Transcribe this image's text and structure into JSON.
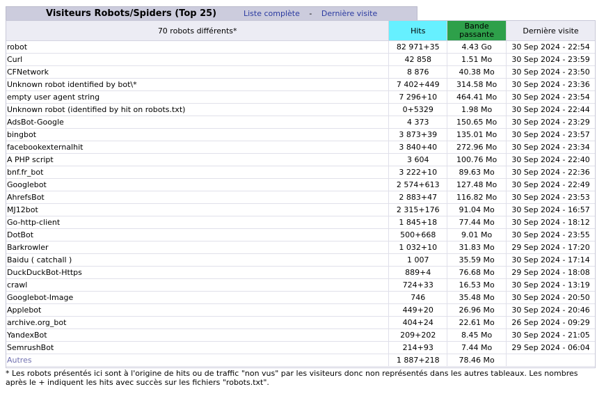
{
  "header": {
    "title": "Visiteurs Robots/Spiders (Top 25)",
    "link_full": "Liste complète",
    "separator": "-",
    "link_last": "Dernière visite"
  },
  "table": {
    "col_name": "70 robots différents*",
    "col_hits": "Hits",
    "col_bandwidth_line1": "Bande",
    "col_bandwidth_line2": "passante",
    "col_last": "Dernière visite",
    "colors": {
      "hits_header": "#66f0ff",
      "bandwidth_header": "#2ea04a"
    },
    "rows": [
      {
        "name": "robot",
        "hits": "82 971+35",
        "bandwidth": "4.43 Go",
        "last": "30 Sep 2024 - 22:54"
      },
      {
        "name": "Curl",
        "hits": "42 858",
        "bandwidth": "1.51 Mo",
        "last": "30 Sep 2024 - 23:59"
      },
      {
        "name": "CFNetwork",
        "hits": "8 876",
        "bandwidth": "40.38 Mo",
        "last": "30 Sep 2024 - 23:50"
      },
      {
        "name": "Unknown robot identified by bot\\*",
        "hits": "7 402+449",
        "bandwidth": "314.58 Mo",
        "last": "30 Sep 2024 - 23:36"
      },
      {
        "name": "empty user agent string",
        "hits": "7 296+10",
        "bandwidth": "464.41 Mo",
        "last": "30 Sep 2024 - 23:54"
      },
      {
        "name": "Unknown robot (identified by hit on robots.txt)",
        "hits": "0+5329",
        "bandwidth": "1.98 Mo",
        "last": "30 Sep 2024 - 22:44"
      },
      {
        "name": "AdsBot-Google",
        "hits": "4 373",
        "bandwidth": "150.65 Mo",
        "last": "30 Sep 2024 - 23:29"
      },
      {
        "name": "bingbot",
        "hits": "3 873+39",
        "bandwidth": "135.01 Mo",
        "last": "30 Sep 2024 - 23:57"
      },
      {
        "name": "facebookexternalhit",
        "hits": "3 840+40",
        "bandwidth": "272.96 Mo",
        "last": "30 Sep 2024 - 23:34"
      },
      {
        "name": "A PHP script",
        "hits": "3 604",
        "bandwidth": "100.76 Mo",
        "last": "30 Sep 2024 - 22:40"
      },
      {
        "name": "bnf.fr_bot",
        "hits": "3 222+10",
        "bandwidth": "89.63 Mo",
        "last": "30 Sep 2024 - 22:36"
      },
      {
        "name": "Googlebot",
        "hits": "2 574+613",
        "bandwidth": "127.48 Mo",
        "last": "30 Sep 2024 - 22:49"
      },
      {
        "name": "AhrefsBot",
        "hits": "2 883+47",
        "bandwidth": "116.82 Mo",
        "last": "30 Sep 2024 - 23:53"
      },
      {
        "name": "MJ12bot",
        "hits": "2 315+176",
        "bandwidth": "91.04 Mo",
        "last": "30 Sep 2024 - 16:57"
      },
      {
        "name": "Go-http-client",
        "hits": "1 845+18",
        "bandwidth": "77.44 Mo",
        "last": "30 Sep 2024 - 18:12"
      },
      {
        "name": "DotBot",
        "hits": "500+668",
        "bandwidth": "9.01 Mo",
        "last": "30 Sep 2024 - 23:55"
      },
      {
        "name": "Barkrowler",
        "hits": "1 032+10",
        "bandwidth": "31.83 Mo",
        "last": "29 Sep 2024 - 17:20"
      },
      {
        "name": "Baidu ( catchall )",
        "hits": "1 007",
        "bandwidth": "35.59 Mo",
        "last": "30 Sep 2024 - 17:14"
      },
      {
        "name": "DuckDuckBot-Https",
        "hits": "889+4",
        "bandwidth": "76.68 Mo",
        "last": "29 Sep 2024 - 18:08"
      },
      {
        "name": "crawl",
        "hits": "724+33",
        "bandwidth": "16.53 Mo",
        "last": "30 Sep 2024 - 13:19"
      },
      {
        "name": "Googlebot-Image",
        "hits": "746",
        "bandwidth": "35.48 Mo",
        "last": "30 Sep 2024 - 20:50"
      },
      {
        "name": "Applebot",
        "hits": "449+20",
        "bandwidth": "26.96 Mo",
        "last": "30 Sep 2024 - 20:46"
      },
      {
        "name": "archive.org_bot",
        "hits": "404+24",
        "bandwidth": "22.61 Mo",
        "last": "26 Sep 2024 - 09:29"
      },
      {
        "name": "YandexBot",
        "hits": "209+202",
        "bandwidth": "8.45 Mo",
        "last": "30 Sep 2024 - 21:05"
      },
      {
        "name": "SemrushBot",
        "hits": "214+93",
        "bandwidth": "7.44 Mo",
        "last": "29 Sep 2024 - 06:04"
      }
    ],
    "others": {
      "name": "Autres",
      "hits": "1 887+218",
      "bandwidth": "78.46 Mo",
      "last": ""
    }
  },
  "footnote": "* Les robots présentés ici sont à l'origine de hits ou de traffic \"non vus\" par les visiteurs donc non représentés dans les autres tableaux. Les nombres après le + indiquent les hits avec succès sur les fichiers \"robots.txt\"."
}
